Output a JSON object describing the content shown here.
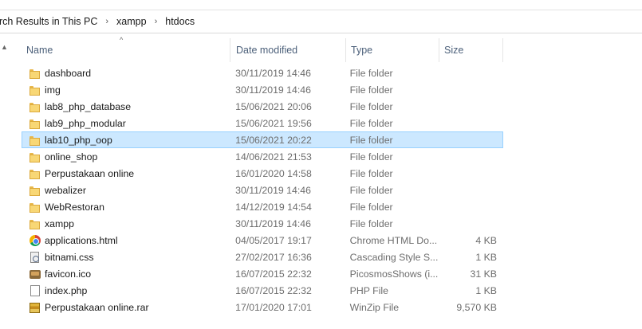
{
  "address": {
    "crumbs": [
      "arch Results in This PC",
      "xampp",
      "htdocs"
    ],
    "separator": "›"
  },
  "columns": {
    "name": "Name",
    "date": "Date modified",
    "type": "Type",
    "size": "Size"
  },
  "files": [
    {
      "name": "dashboard",
      "date": "30/11/2019 14:46",
      "type": "File folder",
      "size": "",
      "icon": "folder-icon"
    },
    {
      "name": "img",
      "date": "30/11/2019 14:46",
      "type": "File folder",
      "size": "",
      "icon": "folder-icon"
    },
    {
      "name": "lab8_php_database",
      "date": "15/06/2021 20:06",
      "type": "File folder",
      "size": "",
      "icon": "folder-icon"
    },
    {
      "name": "lab9_php_modular",
      "date": "15/06/2021 19:56",
      "type": "File folder",
      "size": "",
      "icon": "folder-icon"
    },
    {
      "name": "lab10_php_oop",
      "date": "15/06/2021 20:22",
      "type": "File folder",
      "size": "",
      "icon": "folder-icon",
      "selected": true
    },
    {
      "name": "online_shop",
      "date": "14/06/2021 21:53",
      "type": "File folder",
      "size": "",
      "icon": "folder-icon"
    },
    {
      "name": "Perpustakaan online",
      "date": "16/01/2020 14:58",
      "type": "File folder",
      "size": "",
      "icon": "folder-icon"
    },
    {
      "name": "webalizer",
      "date": "30/11/2019 14:46",
      "type": "File folder",
      "size": "",
      "icon": "folder-icon"
    },
    {
      "name": "WebRestoran",
      "date": "14/12/2019 14:54",
      "type": "File folder",
      "size": "",
      "icon": "folder-icon"
    },
    {
      "name": "xampp",
      "date": "30/11/2019 14:46",
      "type": "File folder",
      "size": "",
      "icon": "folder-icon"
    },
    {
      "name": "applications.html",
      "date": "04/05/2017 19:17",
      "type": "Chrome HTML Do...",
      "size": "4 KB",
      "icon": "chrome-icon"
    },
    {
      "name": "bitnami.css",
      "date": "27/02/2017 16:36",
      "type": "Cascading Style S...",
      "size": "1 KB",
      "icon": "css-icon"
    },
    {
      "name": "favicon.ico",
      "date": "16/07/2015 22:32",
      "type": "PicosmosShows (i...",
      "size": "31 KB",
      "icon": "ico-icon"
    },
    {
      "name": "index.php",
      "date": "16/07/2015 22:32",
      "type": "PHP File",
      "size": "1 KB",
      "icon": "php-icon"
    },
    {
      "name": "Perpustakaan online.rar",
      "date": "17/01/2020 17:01",
      "type": "WinZip File",
      "size": "9,570 KB",
      "icon": "rar-icon"
    }
  ]
}
